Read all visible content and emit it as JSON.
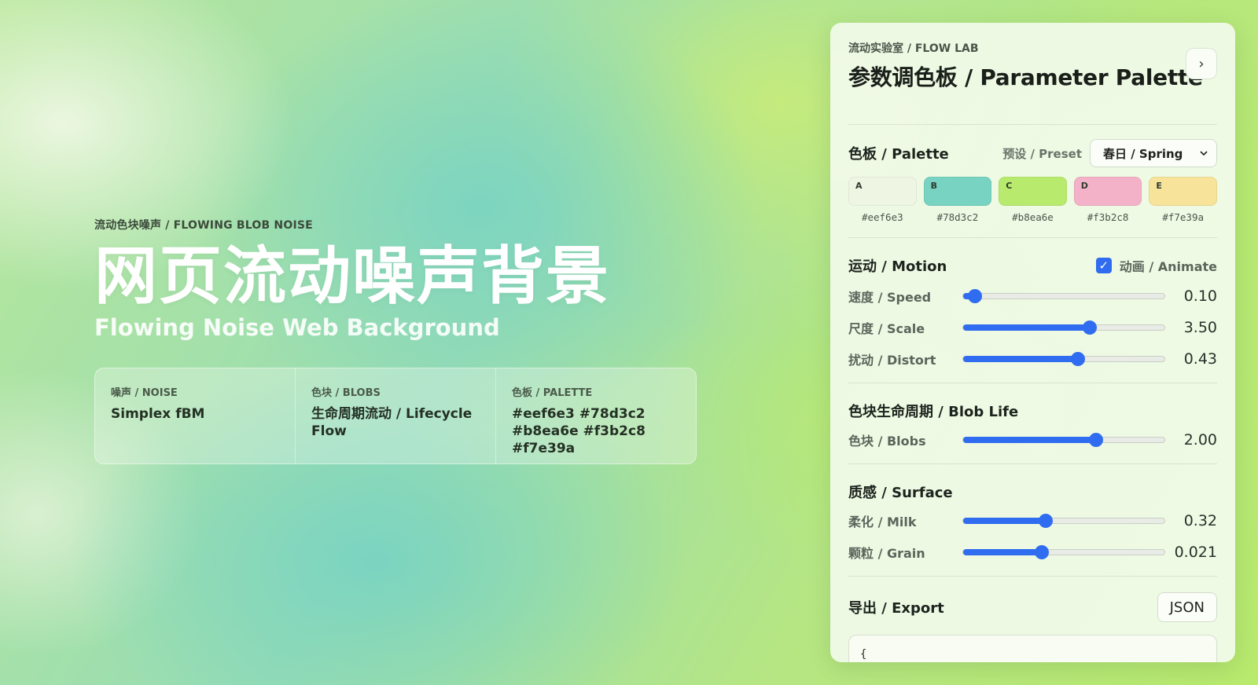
{
  "hero": {
    "eyebrow": "流动色块噪声 / FLOWING BLOB NOISE",
    "title_zh": "网页流动噪声背景",
    "title_en": "Flowing Noise Web Background",
    "info": [
      {
        "label": "噪声 / NOISE",
        "value": "Simplex fBM"
      },
      {
        "label": "色块 / BLOBS",
        "value": "生命周期流动 / Lifecycle Flow"
      },
      {
        "label": "色板 / PALETTE",
        "value": "#eef6e3 #78d3c2 #b8ea6e #f3b2c8 #f7e39a"
      }
    ]
  },
  "panel": {
    "eyebrow": "流动实验室 / FLOW LAB",
    "title": "参数调色板 / Parameter Palette",
    "collapse_glyph": "›",
    "palette": {
      "title": "色板 / Palette",
      "preset_label": "预设 / Preset",
      "preset_value": "春日 / Spring",
      "swatches": [
        {
          "letter": "A",
          "hex": "#eef6e3"
        },
        {
          "letter": "B",
          "hex": "#78d3c2"
        },
        {
          "letter": "C",
          "hex": "#b8ea6e"
        },
        {
          "letter": "D",
          "hex": "#f3b2c8"
        },
        {
          "letter": "E",
          "hex": "#f7e39a"
        }
      ]
    },
    "motion": {
      "title": "运动 / Motion",
      "animate_label": "动画 / Animate",
      "animate_checked": true,
      "sliders": [
        {
          "label": "速度 / Speed",
          "value": "0.10",
          "fraction": 0.06
        },
        {
          "label": "尺度 / Scale",
          "value": "3.50",
          "fraction": 0.63
        },
        {
          "label": "扰动 / Distort",
          "value": "0.43",
          "fraction": 0.57
        }
      ]
    },
    "blob_life": {
      "title": "色块生命周期 / Blob Life",
      "sliders": [
        {
          "label": "色块 / Blobs",
          "value": "2.00",
          "fraction": 0.66
        }
      ]
    },
    "surface": {
      "title": "质感 / Surface",
      "sliders": [
        {
          "label": "柔化 / Milk",
          "value": "0.32",
          "fraction": 0.41
        },
        {
          "label": "颗粒 / Grain",
          "value": "0.021",
          "fraction": 0.39
        }
      ]
    },
    "export": {
      "title": "导出 / Export",
      "button": "JSON",
      "code": "{\n  \"palette\": ["
    }
  },
  "colors": {
    "accent": "#2f6cf0",
    "swatch_a": "#eef6e3",
    "swatch_b": "#78d3c2",
    "swatch_c": "#b8ea6e",
    "swatch_d": "#f3b2c8",
    "swatch_e": "#f7e39a"
  },
  "icons": {
    "collapse": "chevron-right-icon",
    "select": "chevron-down-icon",
    "checkbox": "check-icon"
  }
}
